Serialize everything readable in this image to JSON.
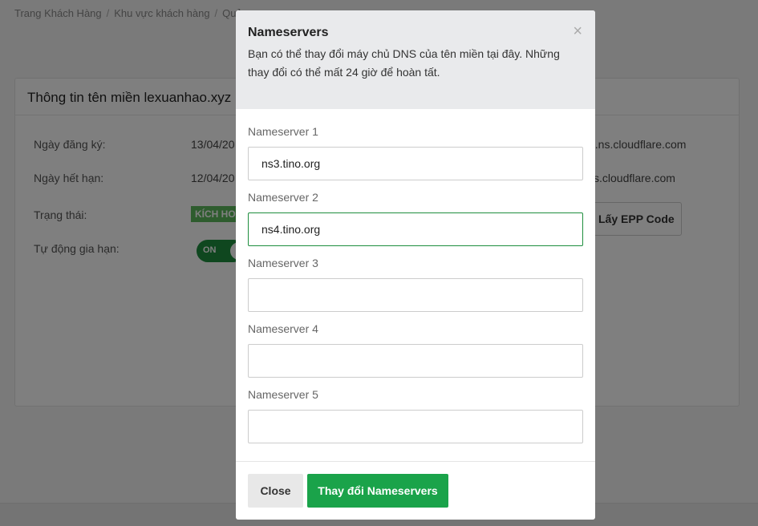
{
  "breadcrumb": {
    "items": [
      "Trang Khách Hàng",
      "Khu vực khách hàng",
      "Quả"
    ]
  },
  "panel": {
    "title": "Thông tin tên miền lexuanhao.xyz",
    "rows": [
      {
        "label": "Ngày đăng ký:",
        "value": "13/04/20"
      },
      {
        "label": "Ngày hết hạn:",
        "value": "12/04/20"
      },
      {
        "label": "Trạng thái:",
        "value": "KÍCH HO"
      },
      {
        "label": "Tự động gia hạn:",
        "value": "ON"
      }
    ],
    "nameservers_right": [
      "e.ns.cloudflare.com",
      "s.cloudflare.com"
    ],
    "epp_button": "Lấy EPP Code"
  },
  "modal": {
    "title": "Nameservers",
    "description": "Bạn có thể thay đổi máy chủ DNS của tên miền tại đây. Những thay đổi có thể mất 24 giờ để hoàn tất.",
    "close_symbol": "×",
    "fields": [
      {
        "label": "Nameserver 1",
        "value": "ns3.tino.org"
      },
      {
        "label": "Nameserver 2",
        "value": "ns4.tino.org"
      },
      {
        "label": "Nameserver 3",
        "value": ""
      },
      {
        "label": "Nameserver 4",
        "value": ""
      },
      {
        "label": "Nameserver 5",
        "value": ""
      }
    ],
    "close_button": "Close",
    "submit_button": "Thay đổi Nameservers"
  },
  "colors": {
    "accent": "#1aa34a",
    "focus_border": "#1e8e3e",
    "overlay": "rgba(0,0,0,0.5)"
  }
}
